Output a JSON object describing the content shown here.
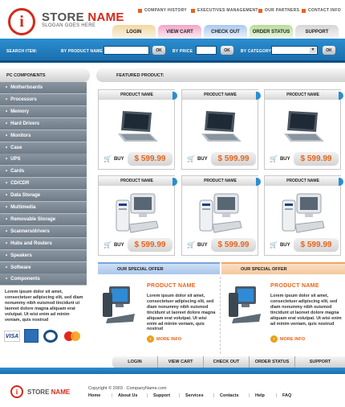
{
  "brand": {
    "logo_letter": "i",
    "name_part1": "STORE ",
    "name_part2": "NAME",
    "slogan": "SLOGAN GOES HERE"
  },
  "top_links": [
    "COMPANY HISTORY",
    "EXECUTIVES MANAGEMENT",
    "OUR PARTNERS",
    "CONTACT INFO"
  ],
  "tabs": [
    "LOGIN",
    "VIEW CART",
    "CHECK OUT",
    "ORDER STATUS",
    "SUPPORT"
  ],
  "search": {
    "label": "SEARCH ITEM:",
    "by_product": "BY PRODUCT NAME",
    "by_price": "BY PRICE",
    "by_category": "BY CATEGORY",
    "ok": "OK"
  },
  "sidebar": {
    "title": "PC COMPONENTS",
    "categories": [
      "Motherboards",
      "Processors",
      "Memory",
      "Hard Drivers",
      "Monitors",
      "Case",
      "UPS",
      "Cards",
      "CD/CDR",
      "Data Storage",
      "Multimedia",
      "Removable Storage",
      "Scanners/drivers",
      "Hubs and Routers",
      "Speakers",
      "Software",
      "Components"
    ],
    "text": "Lorem ipsum dolor sit amet, consectetuer adipiscing elit, sed diam nonummy nibh euismod tincidunt ut laoreet dolore magna aliquam erat volutpat. Ut wisi enim ad minim veniam, quis nostrud",
    "payment_icons": [
      "VISA",
      "AMEX",
      "DINERS",
      "MC"
    ]
  },
  "featured": {
    "title": "FEATURED PRODUCT:",
    "products": [
      {
        "name": "PRODUCT NAME",
        "buy": "BUY",
        "price": "$ 599.99",
        "icon": "laptop-icon"
      },
      {
        "name": "PRODUCT NAME",
        "buy": "BUY",
        "price": "$ 599.99",
        "icon": "laptop-icon"
      },
      {
        "name": "PRODUCT NAME",
        "buy": "BUY",
        "price": "$ 599.99",
        "icon": "laptop-icon"
      },
      {
        "name": "PRODUCT NAME",
        "buy": "BUY",
        "price": "$ 599.99",
        "icon": "desktop-pc-icon"
      },
      {
        "name": "PRODUCT NAME",
        "buy": "BUY",
        "price": "$ 599.99",
        "icon": "desktop-pc-icon"
      },
      {
        "name": "PRODUCT NAME",
        "buy": "BUY",
        "price": "$ 599.99",
        "icon": "desktop-pc-icon"
      }
    ]
  },
  "offers": [
    {
      "head": "OUR SPECIAL OFFER",
      "title": "PRODUCT NAME",
      "text": "Lorem ipsum dolor sit amet, consectetuer adipiscing elit, sed diam nonummy nibh euismod tincidunt ut laoreet dolore magna aliquam erat volutpat. Ut wisi enim ad minim veniam, quis nostrud",
      "more": "MORE INFO"
    },
    {
      "head": "OUR SPECIAL OFFER",
      "title": "PRODUCT NAME",
      "text": "Lorem ipsum dolor sit amet, consectetuer adipiscing elit, sed diam nonummy nibh euismod tincidunt ut laoreet dolore magna aliquam erat volutpat. Ut wisi enim ad minim veniam, quis nostrud",
      "more": "MORE INFO"
    }
  ],
  "bottom_nav": [
    "LOGIN",
    "VIEW CART",
    "CHECK OUT",
    "ORDER STATUS",
    "SUPPORT"
  ],
  "footer": {
    "store_part1": "STORE ",
    "store_part2": "NAME",
    "copyright": "Copyright © 2003 . CompanyName.com",
    "links": [
      "Home",
      "About Us",
      "Support",
      "Services",
      "Contacts",
      "Help",
      "FAQ"
    ]
  },
  "colors": {
    "accent_blue": "#1b6fae",
    "accent_orange": "#e8641a",
    "brand_red": "#d42a1a"
  }
}
